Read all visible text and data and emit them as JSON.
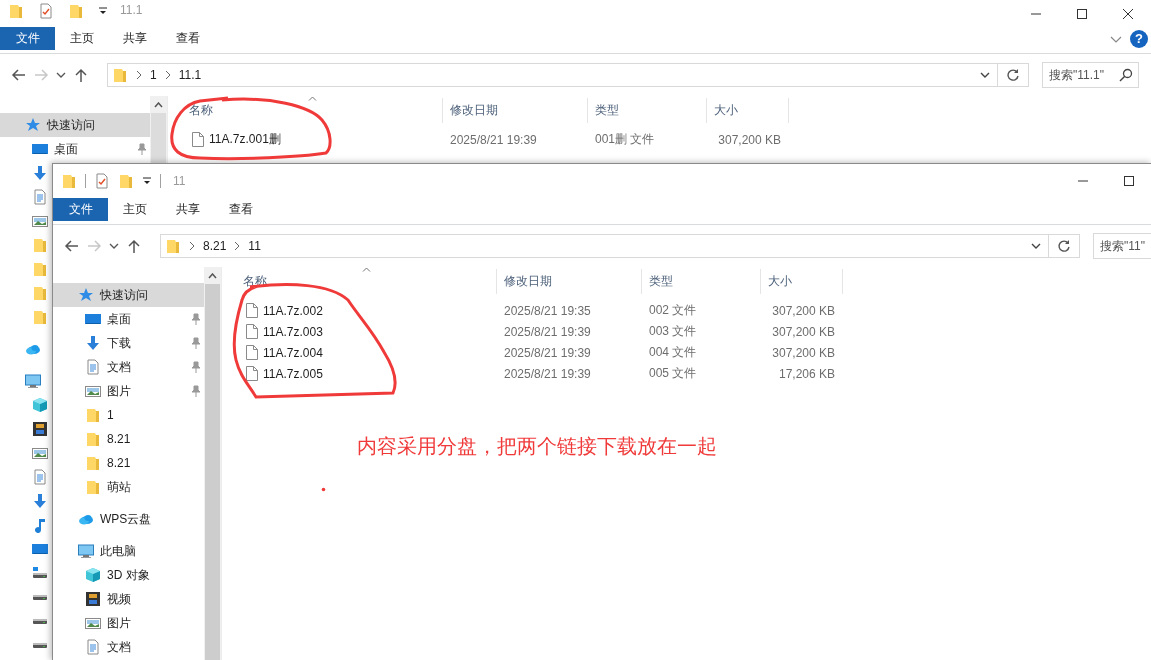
{
  "windows": [
    {
      "title": "11.1",
      "quick_access": [
        {
          "kind": "folder"
        },
        {
          "kind": "properties"
        },
        {
          "kind": "folder"
        },
        {
          "kind": "customize"
        }
      ],
      "window_controls": [
        {
          "kind": "minimize"
        },
        {
          "kind": "maximize"
        },
        {
          "kind": "close"
        }
      ],
      "ribbon_tabs": [
        {
          "label": "文件",
          "selected": true
        },
        {
          "label": "主页",
          "selected": false
        },
        {
          "label": "共享",
          "selected": false
        },
        {
          "label": "查看",
          "selected": false
        }
      ],
      "ribbon_extras": [
        {
          "kind": "collapse"
        },
        {
          "kind": "help",
          "label": "?"
        }
      ],
      "nav": [
        {
          "kind": "back",
          "disabled": false
        },
        {
          "kind": "forward",
          "disabled": true
        },
        {
          "kind": "recent",
          "disabled": false
        },
        {
          "kind": "up",
          "disabled": false
        }
      ],
      "breadcrumbs": [
        "1",
        "11.1"
      ],
      "search": {
        "placeholder": "搜索\"11.1\"",
        "icon": true
      },
      "sidebar": [
        {
          "label": "快速访问",
          "kind": "star",
          "selected": true,
          "children": [
            {
              "label": "桌面",
              "kind": "desktop",
              "pinned": true,
              "selected": false
            },
            {
              "kind": "download",
              "pinned": false,
              "selected": false
            },
            {
              "kind": "document",
              "pinned": false,
              "selected": false
            },
            {
              "kind": "picture",
              "pinned": false,
              "selected": false
            },
            {
              "kind": "folder",
              "pinned": false,
              "selected": false
            },
            {
              "kind": "folder",
              "pinned": false,
              "selected": false
            },
            {
              "kind": "folder",
              "pinned": false,
              "selected": false
            },
            {
              "kind": "folder",
              "pinned": false,
              "selected": false
            }
          ]
        },
        {
          "kind": "cloud",
          "selected": false
        },
        {
          "kind": "pc",
          "selected": false,
          "children": [
            {
              "kind": "cube",
              "selected": false
            },
            {
              "kind": "video",
              "selected": false
            },
            {
              "kind": "picture",
              "selected": false
            },
            {
              "kind": "document",
              "selected": false
            },
            {
              "kind": "download",
              "selected": false
            },
            {
              "kind": "music",
              "selected": false
            },
            {
              "kind": "desktop",
              "selected": false
            },
            {
              "kind": "sysdrive",
              "selected": false
            },
            {
              "kind": "drive",
              "selected": false
            },
            {
              "kind": "drive",
              "selected": false
            },
            {
              "kind": "drive",
              "selected": false
            }
          ]
        }
      ],
      "columns": [
        {
          "label": "名称",
          "sorted": true
        },
        {
          "label": "修改日期",
          "sorted": false
        },
        {
          "label": "类型",
          "sorted": false
        },
        {
          "label": "大小",
          "sorted": false
        }
      ],
      "files": [
        {
          "name": "11A.7z.001删",
          "modified": "2025/8/21 19:39",
          "type": "001删 文件",
          "size": "307,200 KB"
        }
      ]
    },
    {
      "title": "11",
      "quick_access": [
        {
          "kind": "folder"
        },
        {
          "kind": "separator"
        },
        {
          "kind": "properties"
        },
        {
          "kind": "folder"
        },
        {
          "kind": "customize"
        },
        {
          "kind": "separator"
        }
      ],
      "window_controls": [
        {
          "kind": "minimize"
        },
        {
          "kind": "maximize"
        }
      ],
      "ribbon_tabs": [
        {
          "label": "文件",
          "selected": true
        },
        {
          "label": "主页",
          "selected": false
        },
        {
          "label": "共享",
          "selected": false
        },
        {
          "label": "查看",
          "selected": false
        }
      ],
      "nav": [
        {
          "kind": "back",
          "disabled": false
        },
        {
          "kind": "forward",
          "disabled": true
        },
        {
          "kind": "recent",
          "disabled": false
        },
        {
          "kind": "up",
          "disabled": false
        }
      ],
      "breadcrumbs": [
        "8.21",
        "11"
      ],
      "search": {
        "placeholder": "搜索\"11\"",
        "icon": false
      },
      "sidebar": [
        {
          "label": "快速访问",
          "kind": "star",
          "selected": true,
          "children": [
            {
              "label": "桌面",
              "kind": "desktop",
              "pinned": true,
              "selected": false
            },
            {
              "label": "下载",
              "kind": "download",
              "pinned": true,
              "selected": false
            },
            {
              "label": "文档",
              "kind": "document",
              "pinned": true,
              "selected": false
            },
            {
              "label": "图片",
              "kind": "picture",
              "pinned": true,
              "selected": false
            },
            {
              "label": "1",
              "kind": "folder",
              "pinned": false,
              "selected": false
            },
            {
              "label": "8.21",
              "kind": "folder",
              "pinned": false,
              "selected": false
            },
            {
              "label": "8.21",
              "kind": "folder",
              "pinned": false,
              "selected": false
            },
            {
              "label": "萌站",
              "kind": "folder",
              "pinned": false,
              "selected": false
            }
          ]
        },
        {
          "label": "WPS云盘",
          "kind": "cloud",
          "selected": false
        },
        {
          "label": "此电脑",
          "kind": "pc",
          "selected": false,
          "children": [
            {
              "label": "3D 对象",
              "kind": "cube",
              "selected": false
            },
            {
              "label": "视频",
              "kind": "video",
              "selected": false
            },
            {
              "label": "图片",
              "kind": "picture",
              "selected": false
            },
            {
              "label": "文档",
              "kind": "document",
              "selected": false
            }
          ]
        }
      ],
      "columns": [
        {
          "label": "名称",
          "sorted": true
        },
        {
          "label": "修改日期",
          "sorted": false
        },
        {
          "label": "类型",
          "sorted": false
        },
        {
          "label": "大小",
          "sorted": false
        }
      ],
      "files": [
        {
          "name": "11A.7z.002",
          "modified": "2025/8/21 19:35",
          "type": "002 文件",
          "size": "307,200 KB"
        },
        {
          "name": "11A.7z.003",
          "modified": "2025/8/21 19:39",
          "type": "003 文件",
          "size": "307,200 KB"
        },
        {
          "name": "11A.7z.004",
          "modified": "2025/8/21 19:39",
          "type": "004 文件",
          "size": "307,200 KB"
        },
        {
          "name": "11A.7z.005",
          "modified": "2025/8/21 19:39",
          "type": "005 文件",
          "size": "17,206 KB"
        }
      ]
    }
  ],
  "annotation": {
    "text": "内容采用分盘，把两个链接下载放在一起"
  }
}
